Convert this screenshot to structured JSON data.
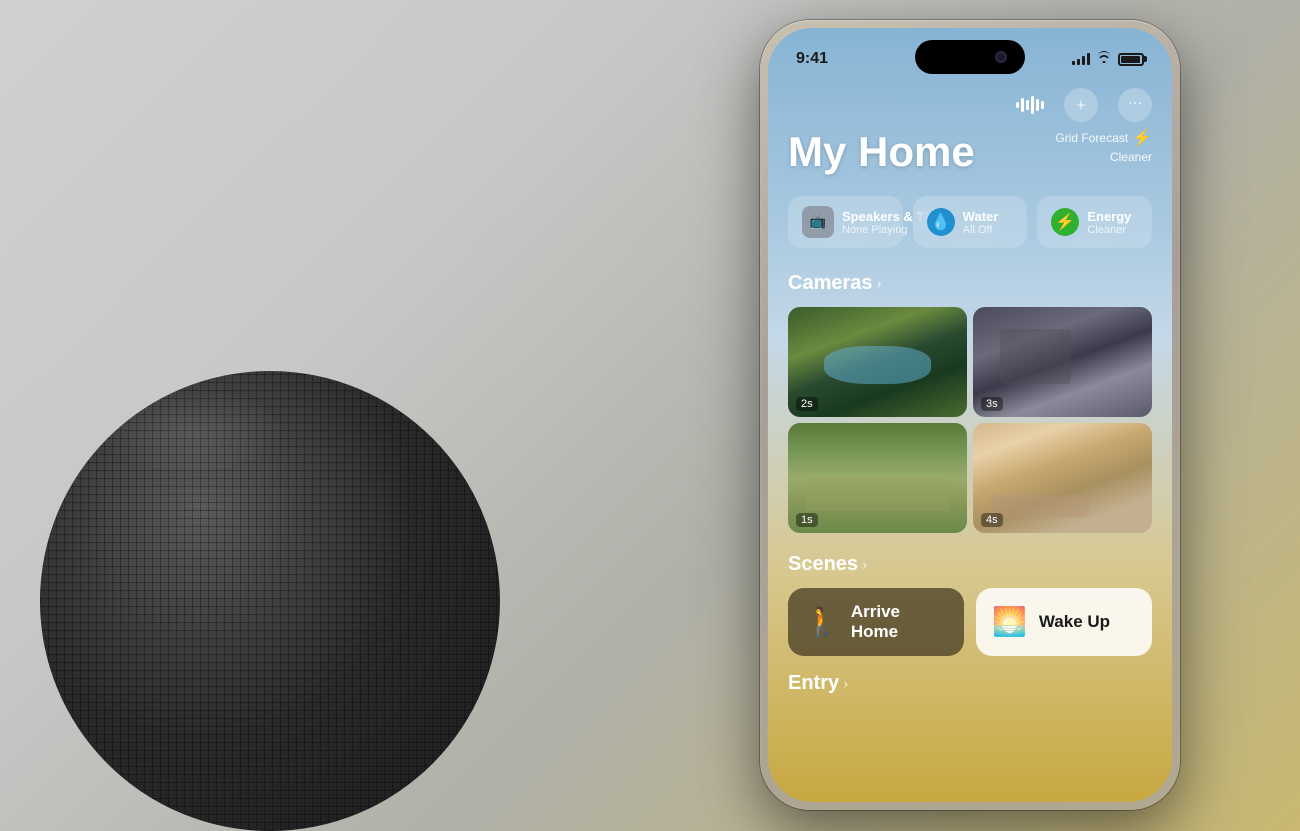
{
  "background": {
    "color": "#d0ccbc"
  },
  "status_bar": {
    "time": "9:41",
    "signal_level": 4,
    "wifi": true,
    "battery_percent": 85
  },
  "top_actions": {
    "waveform_label": "waveform",
    "add_label": "+",
    "more_label": "···"
  },
  "header": {
    "title": "My Home",
    "grid_forecast_line1": "Grid Forecast",
    "grid_forecast_line2": "Cleaner"
  },
  "pills": [
    {
      "icon": "📺",
      "title": "Speakers & TVs",
      "subtitle": "None Playing"
    },
    {
      "icon": "💧",
      "title": "Water",
      "subtitle": "All Off"
    },
    {
      "icon": "⚡",
      "title": "Energy",
      "subtitle": "Cleaner"
    }
  ],
  "cameras": {
    "section_title": "Cameras",
    "items": [
      {
        "label": "2s",
        "type": "pool"
      },
      {
        "label": "3s",
        "type": "gym"
      },
      {
        "label": "1s",
        "type": "outdoor"
      },
      {
        "label": "4s",
        "type": "livingroom"
      }
    ]
  },
  "scenes": {
    "section_title": "Scenes",
    "items": [
      {
        "icon": "🚶",
        "label": "Arrive Home",
        "style": "dark"
      },
      {
        "icon": "🌅",
        "label": "Wake Up",
        "style": "light"
      }
    ]
  },
  "entry": {
    "section_title": "Entry"
  }
}
